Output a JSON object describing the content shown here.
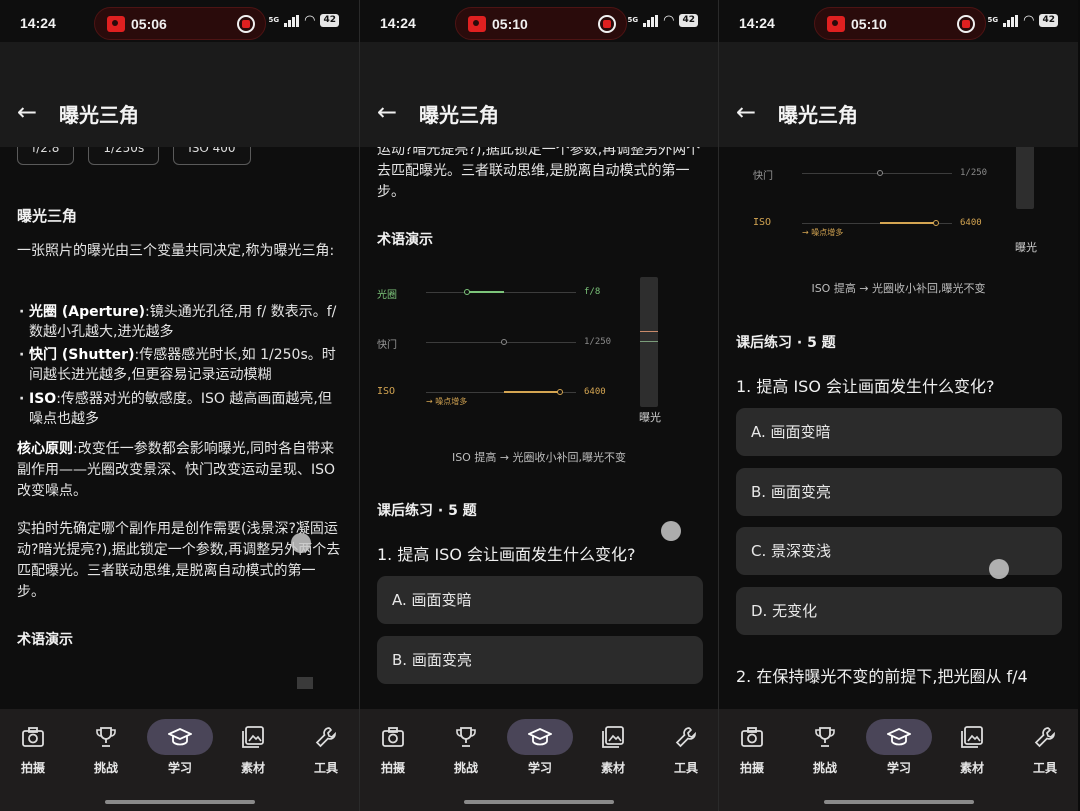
{
  "status": {
    "time": "14:24",
    "net": "5G",
    "battery": "42"
  },
  "screens": [
    {
      "rec_time": "05:06"
    },
    {
      "rec_time": "05:10"
    },
    {
      "rec_time": "05:10"
    }
  ],
  "header": {
    "back": "←",
    "title": "曝光三角"
  },
  "chips": [
    "f/2.8",
    "1/250s",
    "ISO 400"
  ],
  "lesson": {
    "heading": "曝光三角",
    "intro": "一张照片的曝光由三个变量共同决定,称为曝光三角:",
    "bullets": [
      {
        "term": "光圈 (Aperture)",
        "text": ":镜头通光孔径,用 f/ 数表示。f/ 数越小孔越大,进光越多"
      },
      {
        "term": "快门 (Shutter)",
        "text": ":传感器感光时长,如 1/250s。时间越长进光越多,但更容易记录运动模糊"
      },
      {
        "term": "ISO",
        "text": ":传感器对光的敏感度。ISO 越高画面越亮,但噪点也越多"
      }
    ],
    "core_term": "核心原则",
    "core_text": ":改变任一参数都会影响曝光,同时各自带来副作用——光圈改变景深、快门改变运动呈现、ISO 改变噪点。",
    "practice": "实拍时先确定哪个副作用是创作需要(浅景深?凝固运动?暗光提亮?),据此锁定一个参数,再调整另外两个去匹配曝光。三者联动思维,是脱离自动模式的第一步。",
    "practice_tail": "运动?暗光提亮?),据此锁定一个参数,再调整另外两个去匹配曝光。三者联动思维,是脱离自动模式的第一步。",
    "demo_heading": "术语演示"
  },
  "demo": {
    "rows": [
      {
        "label": "光圈",
        "value": "f/8"
      },
      {
        "label": "快门",
        "value": "1/250"
      },
      {
        "label": "ISO",
        "value": "6400"
      }
    ],
    "iso_note": "→ 噪点增多",
    "meter_label": "曝光",
    "caption": "ISO 提高 → 光圈收小补回,曝光不变",
    "colors": {
      "aperture": "#7cc47a",
      "iso": "#d4a552",
      "neutral": "#7a7a7a"
    }
  },
  "quiz": {
    "heading": "课后练习 · 5 题",
    "q1": "1. 提高 ISO 会让画面发生什么变化?",
    "options": [
      "A. 画面变暗",
      "B. 画面变亮",
      "C. 景深变浅",
      "D. 无变化"
    ],
    "q2": "2. 在保持曝光不变的前提下,把光圈从 f/4"
  },
  "nav": [
    {
      "label": "拍摄",
      "icon": "camera-icon"
    },
    {
      "label": "挑战",
      "icon": "trophy-icon"
    },
    {
      "label": "学习",
      "icon": "graduation-cap-icon"
    },
    {
      "label": "素材",
      "icon": "gallery-icon"
    },
    {
      "label": "工具",
      "icon": "wrench-icon"
    }
  ]
}
